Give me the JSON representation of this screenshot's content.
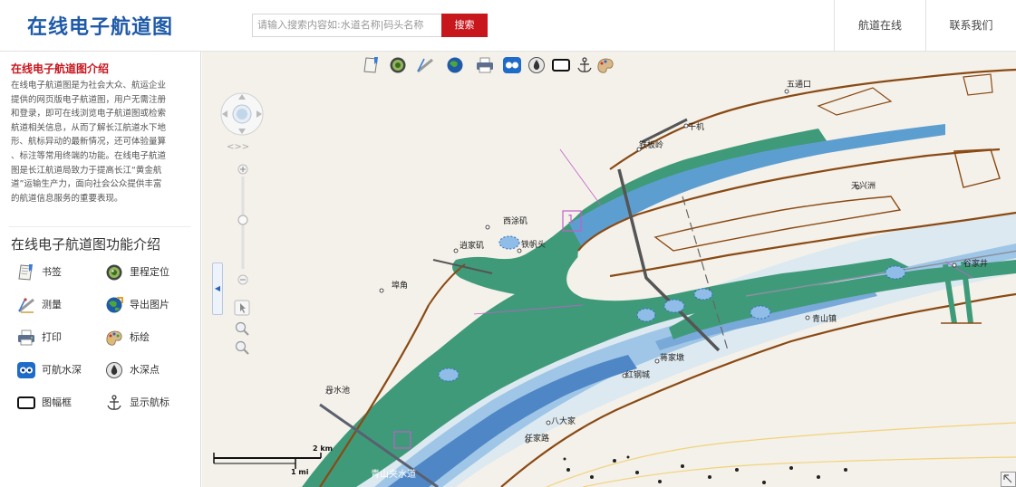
{
  "header": {
    "logo": "在线电子航道图",
    "search_placeholder": "请输入搜索内容如:水道名称|码头名称",
    "search_button": "搜索",
    "nav_online": "航道在线",
    "nav_contact": "联系我们"
  },
  "sidebar": {
    "intro_title": "在线电子航道图介绍",
    "intro_lines": [
      "在线电子航道图是为社会大众、航运企业",
      "提供的网页版电子航道图，用户无需注册",
      "和登录，即可在线浏览电子航道图或检索",
      "航道相关信息，从而了解长江航道水下地",
      "形、航标异动的最新情况，还可体验量算",
      "、标注等常用终端的功能。在线电子航道",
      "图是长江航道局致力于提高长江“黄金航",
      "道”运输生产力，面向社会公众提供丰富",
      "的航道信息服务的重要表现。"
    ],
    "func_title": "在线电子航道图功能介绍",
    "functions": [
      {
        "label": "书签",
        "icon": "bookmark-icon"
      },
      {
        "label": "里程定位",
        "icon": "mileage-locate-icon"
      },
      {
        "label": "测量",
        "icon": "measure-icon"
      },
      {
        "label": "导出图片",
        "icon": "export-image-icon"
      },
      {
        "label": "打印",
        "icon": "print-icon"
      },
      {
        "label": "标绘",
        "icon": "plot-icon"
      },
      {
        "label": "可航水深",
        "icon": "navigable-depth-icon"
      },
      {
        "label": "水深点",
        "icon": "depth-point-icon"
      },
      {
        "label": "图幅框",
        "icon": "map-frame-icon"
      },
      {
        "label": "显示航标",
        "icon": "show-buoy-icon"
      }
    ]
  },
  "map": {
    "labels": {
      "wutongkou": "五通口",
      "tianxingzhou": "天兴洲",
      "tiebanling": "铁板岭",
      "xidaoji": "西涂矶",
      "luojiaji": "逍家矶",
      "tiefantou": "铁帆头",
      "ganting": "干机",
      "dufu": "埠角",
      "qingshanzhen": "青山镇",
      "jiangjiadun": "蒋家墩",
      "hongganggang": "红钢城",
      "danshuichi": "丹水池",
      "badajia": "八大家",
      "renjialu": "任家路",
      "gujiashan": "谷家井",
      "qingshanwater": "青山夹水道"
    },
    "scale_km": "2 km",
    "scale_mi": "1 mi",
    "chart_number": "1"
  }
}
